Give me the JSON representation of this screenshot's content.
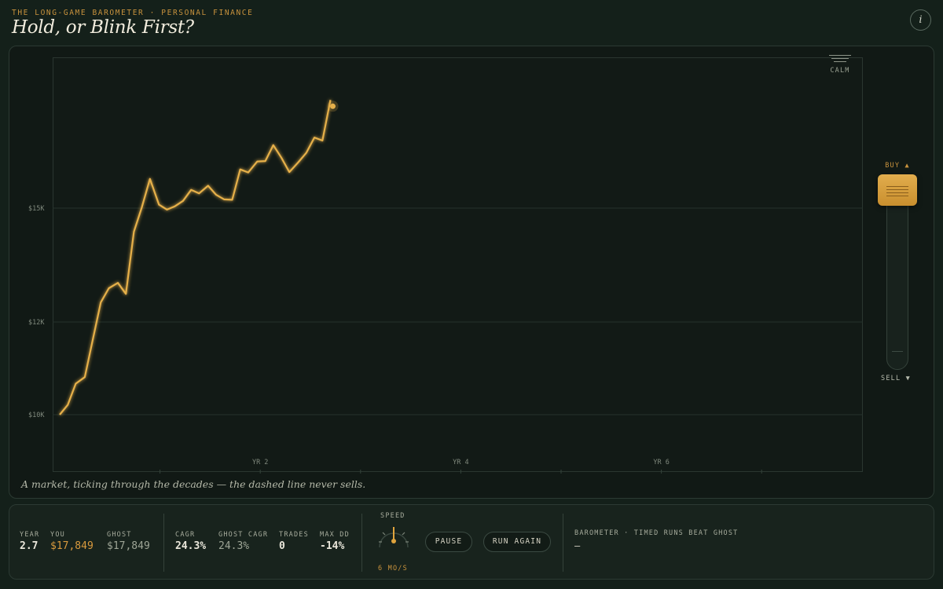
{
  "header": {
    "eyebrow": "THE LONG-GAME BAROMETER · PERSONAL FINANCE",
    "title": "Hold, or Blink First?",
    "info_icon": "info-icon"
  },
  "chart_data": {
    "type": "line",
    "y_ticks": [
      "$10K",
      "$12K",
      "$15K"
    ],
    "x_ticks": [
      "YR 2",
      "YR 4",
      "YR 6"
    ],
    "xlim": [
      0,
      8
    ],
    "series": [
      {
        "color": "#e6b04a",
        "x": [
          0.0,
          0.08,
          0.16,
          0.25,
          0.33,
          0.41,
          0.49,
          0.58,
          0.66,
          0.74,
          0.82,
          0.9,
          0.99,
          1.07,
          1.15,
          1.23,
          1.31,
          1.39,
          1.48,
          1.56,
          1.64,
          1.72,
          1.8,
          1.88,
          1.97,
          2.05,
          2.13,
          2.21,
          2.29,
          2.38,
          2.46,
          2.54,
          2.62,
          2.7
        ],
        "y": [
          10000,
          10210,
          10670,
          10810,
          11620,
          12520,
          12890,
          13030,
          12740,
          14380,
          15030,
          15770,
          15090,
          14960,
          15050,
          15190,
          15480,
          15390,
          15590,
          15350,
          15230,
          15220,
          16020,
          15940,
          16230,
          16240,
          16660,
          16330,
          15950,
          16210,
          16460,
          16860,
          16780,
          17849
        ]
      }
    ],
    "end_value": "$17,849"
  },
  "caption": "A market, ticking through the decades — the dashed line never sells.",
  "barometer": {
    "calm_label": "CALM",
    "buy_label": "BUY ▲",
    "sell_label": "SELL ▼"
  },
  "stats": {
    "year_label": "YEAR",
    "year_value": "2.7",
    "you_label": "YOU",
    "you_value": "$17,849",
    "ghost_label": "GHOST",
    "ghost_value": "$17,849",
    "cagr_label": "CAGR",
    "cagr_value": "24.3%",
    "ghost_cagr_label": "GHOST CAGR",
    "ghost_cagr_value": "24.3%",
    "trades_label": "TRADES",
    "trades_value": "0",
    "max_dd_label": "MAX DD",
    "max_dd_value": "-14%"
  },
  "controls": {
    "speed_label": "SPEED",
    "speed_value": "6 MO/S",
    "pause_label": "PAUSE",
    "run_again_label": "RUN AGAIN"
  },
  "status": {
    "label": "BAROMETER · TIMED RUNS BEAT GHOST",
    "value": "—"
  },
  "colors": {
    "accent": "#c8923d",
    "line": "#e6b04a",
    "background": "#14201a"
  }
}
